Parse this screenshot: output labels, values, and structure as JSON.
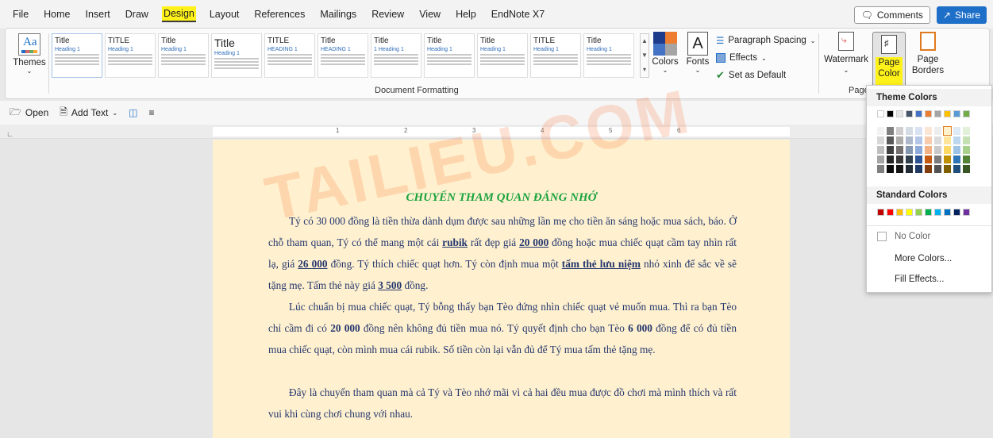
{
  "menu": {
    "items": [
      "File",
      "Home",
      "Insert",
      "Draw",
      "Design",
      "Layout",
      "References",
      "Mailings",
      "Review",
      "View",
      "Help",
      "EndNote X7"
    ],
    "active": "Design",
    "comments_label": "Comments",
    "share_label": "Share"
  },
  "ribbon": {
    "themes_label": "Themes",
    "gallery": [
      {
        "title": "Title",
        "heading": "Heading 1"
      },
      {
        "title": "TITLE",
        "heading": "Heading 1"
      },
      {
        "title": "Title",
        "heading": "Heading 1"
      },
      {
        "title": "Title",
        "heading": "Heading 1"
      },
      {
        "title": "TITLE",
        "heading": "HEADING 1"
      },
      {
        "title": "Title",
        "heading": "HEADING 1"
      },
      {
        "title": "Title",
        "heading": "1 Heading 1"
      },
      {
        "title": "Title",
        "heading": "Heading 1"
      },
      {
        "title": "Title",
        "heading": "Heading 1"
      },
      {
        "title": "TITLE",
        "heading": "Heading 1"
      },
      {
        "title": "Title",
        "heading": "Heading 1"
      }
    ],
    "document_formatting_label": "Document Formatting",
    "colors_label": "Colors",
    "fonts_label": "Fonts",
    "paragraph_spacing_label": "Paragraph Spacing",
    "effects_label": "Effects",
    "set_default_label": "Set as Default",
    "watermark_label": "Watermark",
    "page_color_line1": "Page",
    "page_color_line2": "Color",
    "page_borders_line1": "Page",
    "page_borders_line2": "Borders",
    "page_background_label": "Page"
  },
  "quickbar": {
    "open_label": "Open",
    "add_text_label": "Add Text"
  },
  "ruler": {
    "numbers": [
      "1",
      "2",
      "3",
      "4",
      "5",
      "6"
    ]
  },
  "document": {
    "title": "CHUYẾN THAM QUAN ĐÁNG NHỚ",
    "p1": [
      {
        "t": "Tý có 30 000 đồng là tiền thừa dành dụm được sau những lần mẹ cho tiền ăn sáng hoặc mua sách, báo. Ở chỗ tham quan, Tý có thể mang một cái ",
        "s": ""
      },
      {
        "t": "rubik",
        "s": "u"
      },
      {
        "t": " rất đẹp giá ",
        "s": ""
      },
      {
        "t": "20 000",
        "s": "u"
      },
      {
        "t": " đồng hoặc mua  chiếc quạt cầm tay nhìn rất lạ, giá ",
        "s": ""
      },
      {
        "t": "26 000",
        "s": "u"
      },
      {
        "t": " đồng. Tý thích chiếc quạt hơn. Tý còn định mua một ",
        "s": ""
      },
      {
        "t": "tấm thẻ lưu niệm",
        "s": "u"
      },
      {
        "t": " nhỏ xinh để sắc về sẽ tặng mẹ. Tấm thẻ này giá ",
        "s": ""
      },
      {
        "t": "3 500",
        "s": "u"
      },
      {
        "t": " đồng.",
        "s": ""
      }
    ],
    "p2": [
      {
        "t": "Lúc chuẩn bị mua chiếc quạt, Tý bỗng thấy bạn Tèo đứng nhìn chiếc quạt vẻ muốn mua. Thì ra bạn Tèo chỉ cầm đi có ",
        "s": ""
      },
      {
        "t": "20 000",
        "s": "b"
      },
      {
        "t": " đồng nên không đủ tiền mua nó. Tý quyết định cho bạn Tèo ",
        "s": ""
      },
      {
        "t": "6 000",
        "s": "b"
      },
      {
        "t": " đồng để có đủ tiền mua chiếc quạt, còn mình mua cái rubik. Số tiền còn lại vẫn đủ để Tý mua tấm thẻ tặng mẹ.",
        "s": ""
      }
    ],
    "p3": [
      {
        "t": "Đây là chuyến tham quan mà cả Tý và Tèo nhớ mãi vì cả hai đều mua được đồ chơi mà mình thích và rất vui khi cùng chơi chung với nhau.",
        "s": ""
      }
    ]
  },
  "watermark_text": "TAILIEU.COM",
  "dropdown": {
    "theme_colors_label": "Theme Colors",
    "theme_row": [
      "#ffffff",
      "#000000",
      "#e7e6e6",
      "#44546a",
      "#4472c4",
      "#ed7d31",
      "#a5a5a5",
      "#ffc000",
      "#5b9bd5",
      "#70ad47"
    ],
    "shades": [
      [
        "#f2f2f2",
        "#7f7f7f",
        "#d0cece",
        "#d6dce4",
        "#d9e2f3",
        "#fbe5d5",
        "#ededed",
        "#fff2cc",
        "#deebf6",
        "#e2efd9"
      ],
      [
        "#d8d8d8",
        "#595959",
        "#aeabab",
        "#adb9ca",
        "#b4c6e7",
        "#f7cbac",
        "#dbdbdb",
        "#fee599",
        "#bdd7ee",
        "#c5e0b3"
      ],
      [
        "#bfbfbf",
        "#3f3f3f",
        "#757070",
        "#8496b0",
        "#8eaadb",
        "#f4b183",
        "#c9c9c9",
        "#ffd965",
        "#9cc3e5",
        "#a8d08d"
      ],
      [
        "#a5a5a5",
        "#262626",
        "#3a3838",
        "#323f4f",
        "#2f5496",
        "#c55a11",
        "#7b7b7b",
        "#bf9000",
        "#2e75b5",
        "#538135"
      ],
      [
        "#7f7f7f",
        "#0c0c0c",
        "#171616",
        "#222a35",
        "#1f3864",
        "#833c0b",
        "#525252",
        "#7f6000",
        "#1e4e79",
        "#375623"
      ]
    ],
    "selected_index": 7,
    "standard_colors_label": "Standard Colors",
    "standard_row": [
      "#c00000",
      "#ff0000",
      "#ffc000",
      "#ffff00",
      "#92d050",
      "#00b050",
      "#00b0f0",
      "#0070c0",
      "#002060",
      "#7030a0"
    ],
    "no_color_label": "No Color",
    "more_colors_label": "More Colors...",
    "fill_effects_label": "Fill Effects..."
  }
}
